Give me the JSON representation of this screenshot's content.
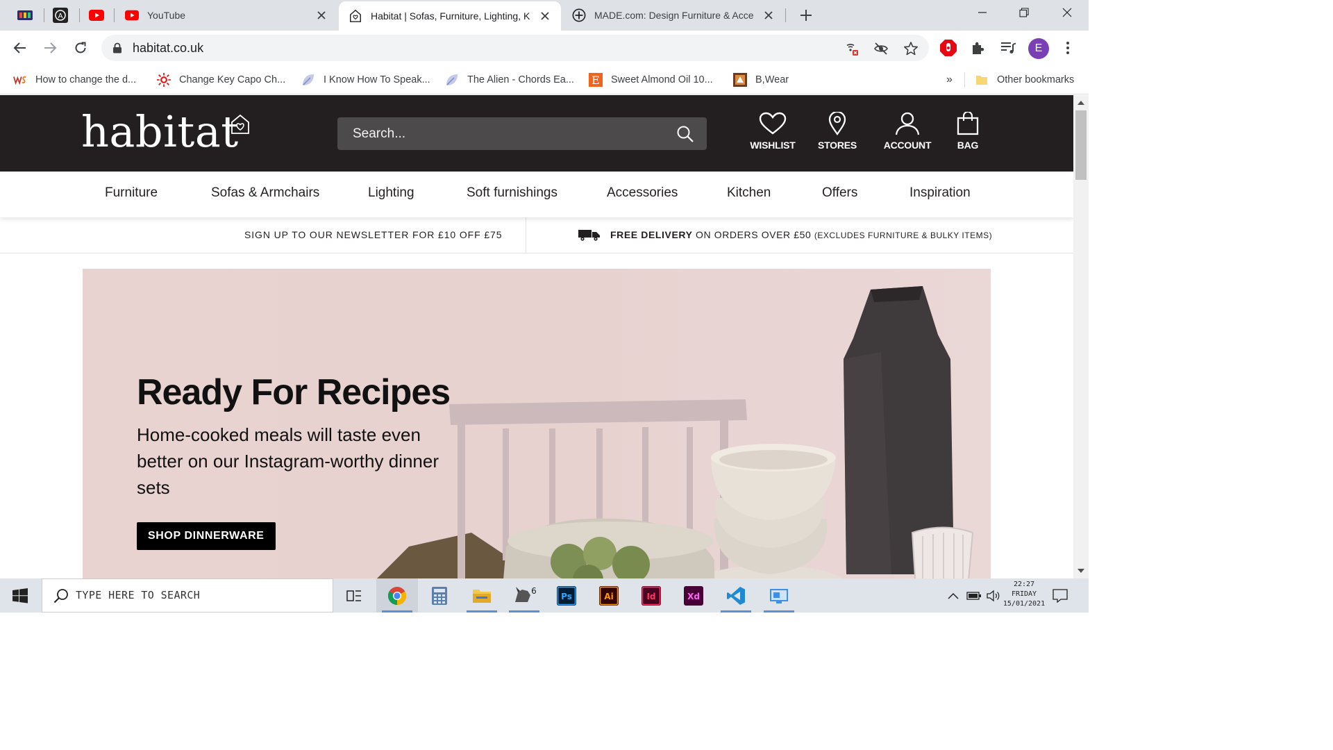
{
  "browser": {
    "pinned_tabs": [
      {
        "icon": "multicolor-app-icon"
      },
      {
        "icon": "circle-a-logo-icon"
      },
      {
        "icon": "youtube-icon"
      }
    ],
    "tabs": [
      {
        "title": "YouTube",
        "icon": "youtube-icon",
        "active": false
      },
      {
        "title": "Habitat | Sofas, Furniture, Lighting, K",
        "icon": "habitat-house-icon",
        "active": true
      },
      {
        "title": "MADE.com: Design Furniture & Acce",
        "icon": "made-plus-icon",
        "active": false
      }
    ],
    "url": "habitat.co.uk",
    "profile_initial": "E",
    "bookmarks": [
      {
        "label": "How to change the d...",
        "icon": "ws-logo-icon"
      },
      {
        "label": "Change Key Capo Ch...",
        "icon": "red-sun-icon"
      },
      {
        "label": "I Know How To Speak...",
        "icon": "leaf-icon"
      },
      {
        "label": "The Alien - Chords Ea...",
        "icon": "leaf-icon"
      },
      {
        "label": "Sweet Almond Oil 10...",
        "icon": "etsy-e-icon"
      },
      {
        "label": "B,Wear",
        "icon": "bwear-icon"
      }
    ],
    "bookmarks_overflow": "»",
    "other_bookmarks": "Other bookmarks"
  },
  "site": {
    "logo_text": "habitat",
    "search_placeholder": "Search...",
    "header_nav": [
      {
        "label": "WISHLIST",
        "icon": "heart-icon"
      },
      {
        "label": "STORES",
        "icon": "location-pin-icon"
      },
      {
        "label": "ACCOUNT",
        "icon": "person-icon"
      },
      {
        "label": "BAG",
        "icon": "shopping-bag-icon"
      }
    ],
    "categories": [
      "Furniture",
      "Sofas & Armchairs",
      "Lighting",
      "Soft furnishings",
      "Accessories",
      "Kitchen",
      "Offers",
      "Inspiration"
    ],
    "promo": {
      "newsletter": "SIGN UP TO OUR NEWSLETTER FOR £10 OFF £75",
      "delivery_bold": "FREE DELIVERY",
      "delivery_text": " ON ORDERS OVER £50 ",
      "delivery_note": "(EXCLUDES FURNITURE & BULKY ITEMS)"
    },
    "hero": {
      "title": "Ready For Recipes",
      "body": "Home-cooked meals will taste even better on our Instagram-worthy dinner sets",
      "cta": "SHOP DINNERWARE"
    }
  },
  "taskbar": {
    "search_placeholder": "TYPE HERE TO SEARCH",
    "apps": [
      "task-view-icon",
      "chrome-icon",
      "calculator-icon",
      "file-explorer-icon",
      "rhino-icon",
      "photoshop-icon",
      "illustrator-icon",
      "indesign-icon",
      "xd-icon",
      "vscode-icon",
      "remote-desktop-icon"
    ],
    "app_labels": {
      "rhino": "6",
      "photoshop": "Ps",
      "illustrator": "Ai",
      "indesign": "Id",
      "xd": "Xd"
    },
    "clock": {
      "time": "22:27",
      "day": "FRIDAY",
      "date": "15/01/2021"
    }
  },
  "colors": {
    "header_bg": "#231f20",
    "search_bg": "#4d4a4b",
    "hero_bg": "#e8d3d1",
    "tabstrip_bg": "#dee1e6"
  }
}
